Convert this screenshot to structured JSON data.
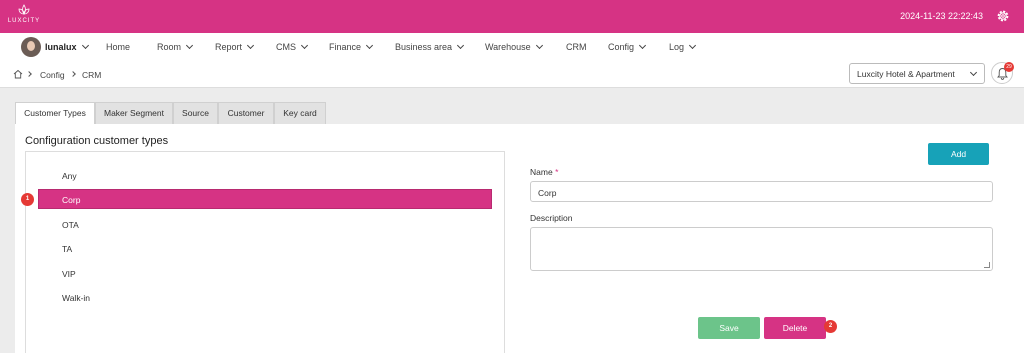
{
  "topbar": {
    "logo_text": "LUXCITY",
    "datetime": "2024-11-23 22:22:43",
    "brand_color": "#d63384"
  },
  "nav": {
    "user": "lunalux",
    "items": [
      {
        "label": "Home",
        "dropdown": false
      },
      {
        "label": "Room",
        "dropdown": true
      },
      {
        "label": "Report",
        "dropdown": true
      },
      {
        "label": "CMS",
        "dropdown": true
      },
      {
        "label": "Finance",
        "dropdown": true
      },
      {
        "label": "Business area",
        "dropdown": true
      },
      {
        "label": "Warehouse",
        "dropdown": true
      },
      {
        "label": "CRM",
        "dropdown": false
      },
      {
        "label": "Config",
        "dropdown": true
      },
      {
        "label": "Log",
        "dropdown": true
      }
    ]
  },
  "breadcrumb": {
    "items": [
      "Config",
      "CRM"
    ]
  },
  "hotel_select": {
    "value": "Luxcity Hotel & Apartment"
  },
  "notifications": {
    "badge": "29"
  },
  "tabs": [
    {
      "label": "Customer Types",
      "active": true
    },
    {
      "label": "Maker Segment",
      "active": false
    },
    {
      "label": "Source",
      "active": false
    },
    {
      "label": "Customer",
      "active": false
    },
    {
      "label": "Key card",
      "active": false
    }
  ],
  "main": {
    "title": "Configuration customer types",
    "list": [
      "Any",
      "Corp",
      "OTA",
      "TA",
      "VIP",
      "Walk-in"
    ],
    "selected_index": 1,
    "selected_marker": "1"
  },
  "form": {
    "add_label": "Add",
    "name_label": "Name",
    "required_mark": "*",
    "name_value": "Corp",
    "description_label": "Description",
    "description_value": "",
    "save_label": "Save",
    "delete_label": "Delete",
    "delete_marker": "2"
  }
}
